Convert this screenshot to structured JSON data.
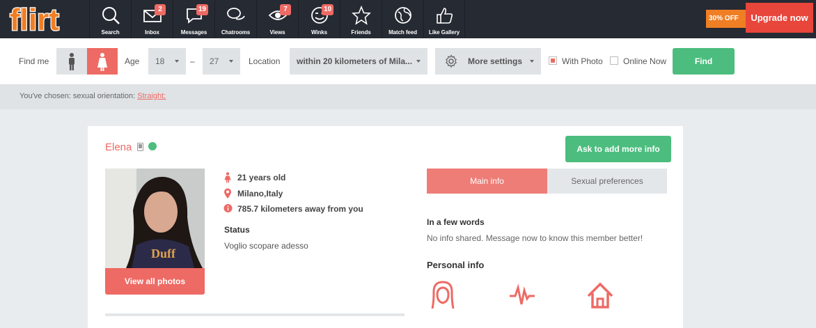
{
  "brand": {
    "logo_text": "flirt",
    "accent": "#ee6a64",
    "green": "#4cbd7e",
    "orange": "#f07e24"
  },
  "nav": {
    "items": [
      {
        "label": "Search",
        "icon": "search-icon",
        "badge": ""
      },
      {
        "label": "Inbox",
        "icon": "envelope-icon",
        "badge": "2"
      },
      {
        "label": "Messages",
        "icon": "speech-bubble-icon",
        "badge": "19"
      },
      {
        "label": "Chatrooms",
        "icon": "chat-bubbles-icon",
        "badge": ""
      },
      {
        "label": "Views",
        "icon": "eye-icon",
        "badge": "7"
      },
      {
        "label": "Winks",
        "icon": "wink-face-icon",
        "badge": "10"
      },
      {
        "label": "Friends",
        "icon": "star-icon",
        "badge": ""
      },
      {
        "label": "Match feed",
        "icon": "globe-icon",
        "badge": ""
      },
      {
        "label": "Like Gallery",
        "icon": "thumbs-up-icon",
        "badge": ""
      }
    ],
    "promo": "30% OFF",
    "upgrade_label": "Upgrade now"
  },
  "filter": {
    "find_me_label": "Find me",
    "age_label": "Age",
    "age_min": "18",
    "age_dash": "–",
    "age_max": "27",
    "location_label": "Location",
    "location_value": "within 20 kilometers of Mila...",
    "more_settings_label": "More settings",
    "with_photo_label": "With Photo",
    "with_photo_checked": true,
    "online_now_label": "Online Now",
    "online_now_checked": false,
    "find_label": "Find"
  },
  "chosen": {
    "prefix": "You've chosen: sexual orientation: ",
    "link": "Straight;"
  },
  "profile": {
    "name": "Elena",
    "age_text": "21 years old",
    "location_text": "Milano,Italy",
    "distance_text": "785.7 kilometers away from you",
    "status_heading": "Status",
    "status_text": "Voglio scopare adesso",
    "view_photos_label": "View all photos",
    "ask_label": "Ask to add more info",
    "tabs": [
      {
        "label": "Main info",
        "active": true
      },
      {
        "label": "Sexual preferences",
        "active": false
      }
    ],
    "few_words_heading": "In a few words",
    "few_words_text": "No info shared. Message now to know this member better!",
    "personal_info_heading": "Personal info"
  }
}
